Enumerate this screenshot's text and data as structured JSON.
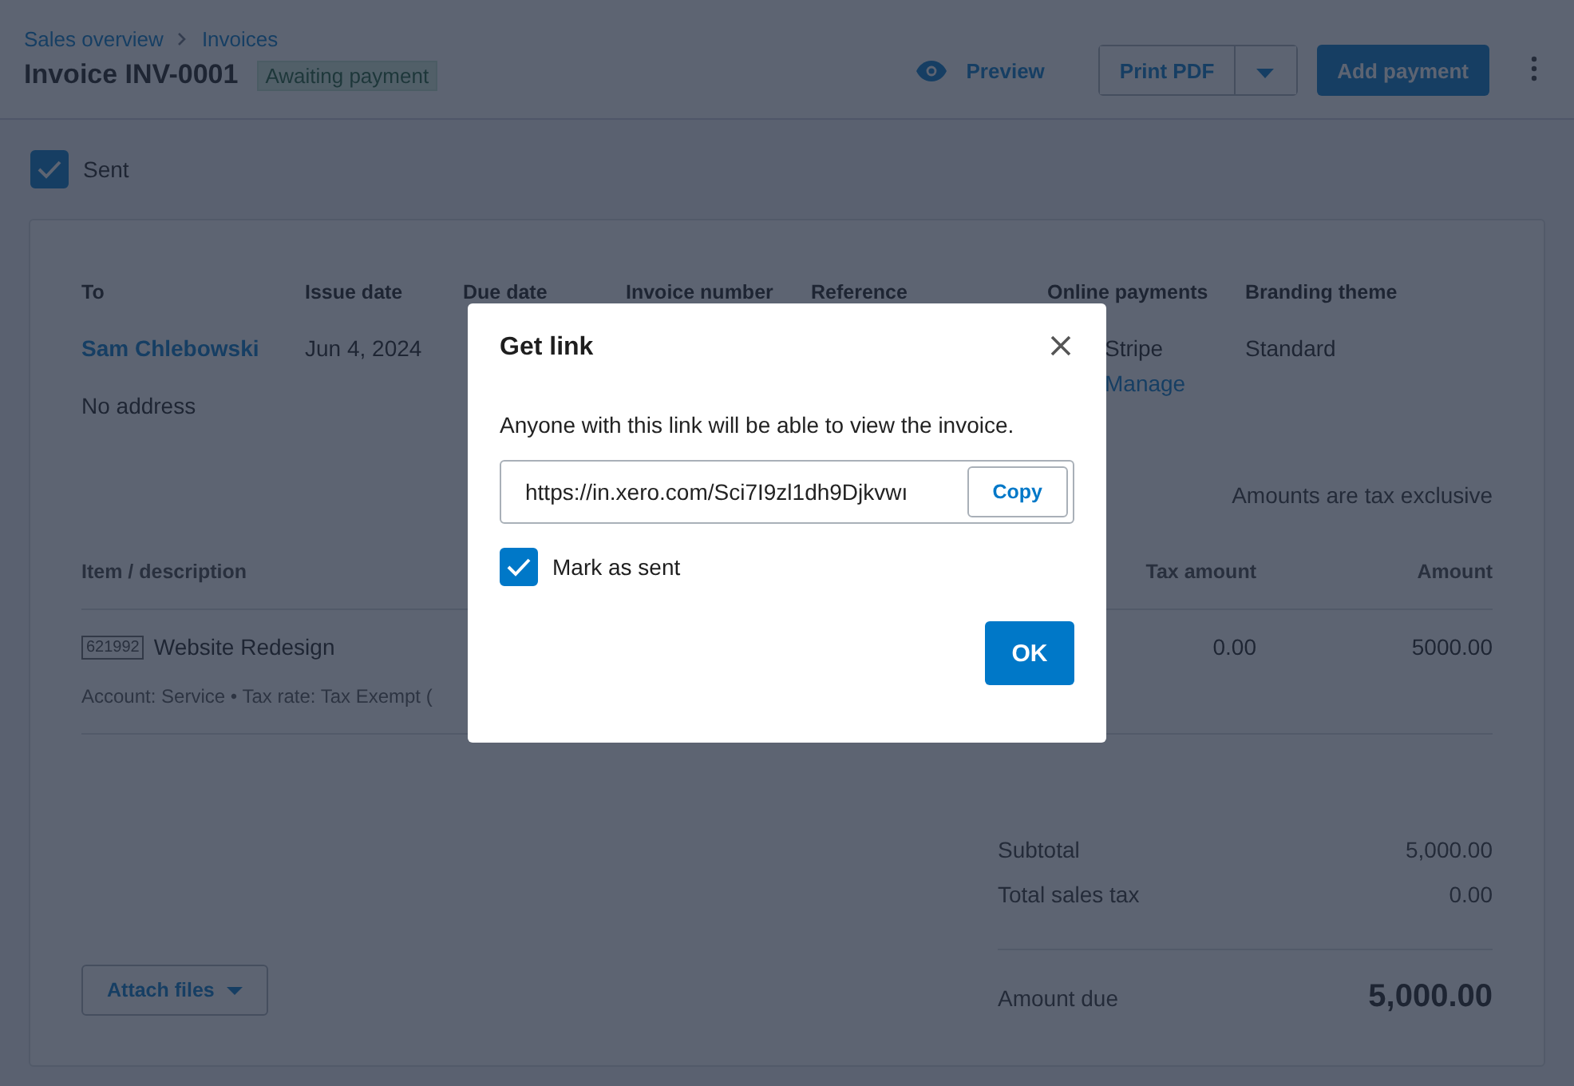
{
  "breadcrumbs": [
    {
      "label": "Sales overview"
    },
    {
      "label": "Invoices"
    }
  ],
  "title": "Invoice INV-0001",
  "status": "Awaiting payment",
  "actions": {
    "preview": "Preview",
    "print": "Print PDF",
    "primary": "Add payment"
  },
  "sent": {
    "label": "Sent",
    "checked": true
  },
  "details": [
    {
      "heading": "To",
      "value": "Sam Chlebowski",
      "kind": "link",
      "extra": "No address"
    },
    {
      "heading": "Issue date",
      "value": "Jun 4, 2024",
      "kind": "text"
    },
    {
      "heading": "Due date"
    },
    {
      "heading": "Invoice number"
    },
    {
      "heading": "Reference"
    },
    {
      "heading": "Online payments",
      "value": "Stripe",
      "kind": "text",
      "link": "Manage"
    },
    {
      "heading": "Branding theme",
      "value": "Standard",
      "kind": "text"
    }
  ],
  "tax_note": "Amounts are tax exclusive",
  "table": {
    "columns": [
      "Item / description",
      "Tax amount",
      "Amount"
    ],
    "rows": [
      {
        "code": "621992",
        "description": "Website Redesign",
        "tax": "0.00",
        "amount": "5000.00",
        "meta": "Account: Service • Tax rate: Tax Exempt ("
      }
    ]
  },
  "totals": [
    {
      "label": "Subtotal",
      "value": "5,000.00",
      "kind": "line"
    },
    {
      "label": "Total sales tax",
      "value": "0.00",
      "kind": "line"
    },
    {
      "label": "Amount due",
      "value": "5,000.00",
      "kind": "due"
    }
  ],
  "attach": "Attach files",
  "dialog": {
    "title": "Get link",
    "message": "Anyone with this link will be able to view the invoice.",
    "link": "https://in.xero.com/Sci7I9zl1dh9Djkvwı",
    "copy": "Copy",
    "mark_sent": {
      "label": "Mark as sent",
      "checked": true
    },
    "ok": "OK"
  }
}
